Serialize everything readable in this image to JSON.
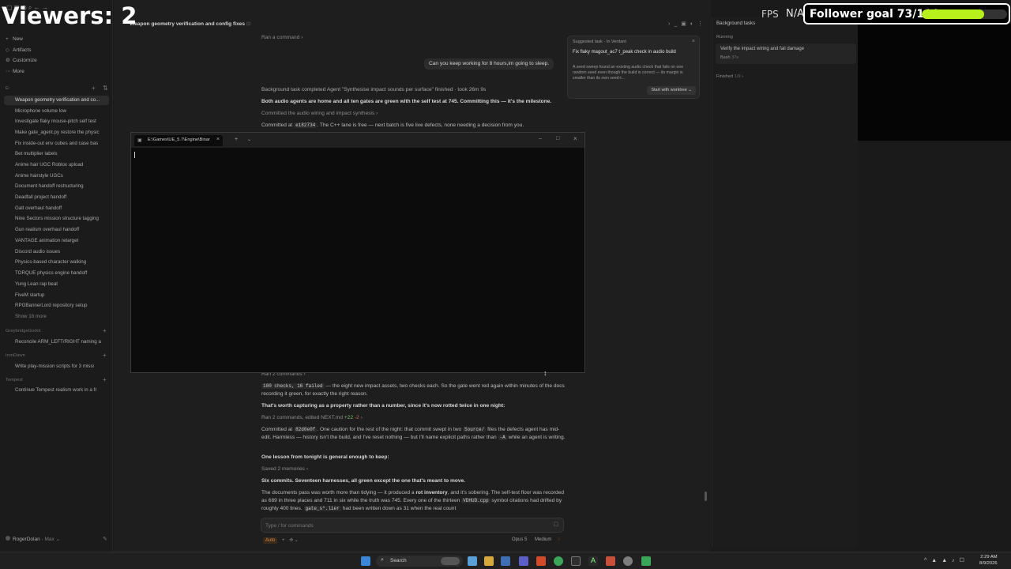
{
  "overlay": {
    "viewers": "Viewers: 2",
    "fps_label": "FPS",
    "fps_value": "N/A",
    "follower_goal": "Follower goal 73/100",
    "goal_progress": 0.73
  },
  "sidebar": {
    "nav": [
      "New",
      "Artifacts",
      "Customize",
      "More"
    ],
    "threads": [
      "Weapon geometry verification and co...",
      "Microphone volume low",
      "Investigate flaky mouse-pitch self test",
      "Make gate_agent.py restore the physic",
      "Fix inside-out env cubes and case bas",
      "Bet multiplier labels",
      "Anime hair UGC Roblox upload",
      "Anime hairstyle UGCs",
      "Document handoff restructuring",
      "Deadfall project handoff",
      "Galt overhaul handoff",
      "Nine Sectors mission structure tagging",
      "Gun realism overhaul handoff",
      "VANTAGE animation retarget",
      "Discord audio issues",
      "Physics-based character walking",
      "TORQUE physics engine handoff",
      "Yung Lean rap beat",
      "FiveM startup",
      "RPGBannerLord repository setup"
    ],
    "show_more": "Show 18 more",
    "groups": [
      {
        "name": "GreybridgeGodot",
        "item": "Reconcile ARM_LEFT/RIGHT naming a"
      },
      {
        "name": "IronDawn",
        "item": "Write play-mission scripts for 3 missi"
      },
      {
        "name": "Tempest",
        "item": "Continue Tempest realism work in a fr"
      }
    ],
    "user": "RogerDolan",
    "plan": "Max"
  },
  "header": {
    "title": "Weapon geometry verification and config fixes",
    "ran": "Ran a command"
  },
  "chat": {
    "user_msg": "Can you keep working for 8 hours,im going to sleep.",
    "bg_done": "Background task completed Agent \"Synthesise impact sounds per surface\" finished · took 26m 9s",
    "audio_home": "Both audio agents are home and all ten gates are green with the self test at 745. Committing this — it's the milestone.",
    "committed_link": "Committed the audio wiring and impact synthesis",
    "commit1_pre": "Committed at",
    "commit1_hash": "e182734",
    "commit1_post": ". The C++ lane is free — next batch is five live defects, none needing a decision from you.",
    "ran2": "Ran 2 commands",
    "checks_code": "100 checks, 16 failed",
    "checks_text": " — the eight new impact assets, two checks each. So the gate went red again within minutes of the docs recording it green, for exactly the right reason.",
    "capture": "That's worth capturing as a property rather than a number, since it's now rotted twice in one night:",
    "ran_edited": "Ran 2 commands, edited NEXT.md",
    "added": "+22",
    "removed": "-2",
    "commit2_pre": "Committed at",
    "commit2_hash": "82d0e0f",
    "commit2_mid": ". One caution for the rest of the night: that commit swept in two",
    "commit2_code": "Source/",
    "commit2_post": "files the defects agent has mid-edit. Harmless — history isn't the build, and I've reset nothing — but I'll name explicit paths rather than",
    "commit2_flag": "-A",
    "commit2_end": "while an agent is writing.",
    "lesson": "One lesson from tonight is general enough to keep:",
    "saved": "Saved 2 memories",
    "six": "Six commits. Seventeen harnesses, all green except the one that's meant to move.",
    "docs_a": "The documents pass was worth more than tidying — it produced a",
    "docs_b": "rot inventory",
    "docs_c": ", and it's sobering. The self-test floor was recorded as 689 in three places and 711 in six while the truth was 745. Every one of the thirteen",
    "docs_code": "VDHUD.cpp",
    "docs_d": "symbol citations had drifted by roughly 400 lines.",
    "docs_code2": "gate_s*.lier",
    "docs_e": "had been written down as 31 when the real count"
  },
  "composer": {
    "placeholder": "Type / for commands",
    "mode": "Auto",
    "model": "Opus 5",
    "effort": "Medium"
  },
  "suggested": {
    "header": "Suggested task · In Verdant",
    "title": "Fix flaky magout_ac7 t_peak check in audio build",
    "body": "A seed sweep found an existing audio check that fails on one random seed even though the build is correct — its margin is smaller than its own seed-t...",
    "button": "Start with worktree"
  },
  "bg_tasks": {
    "title": "Background tasks",
    "running_label": "Running",
    "task": "Verify the impact wiring and fail damage",
    "task_meta": "Bash",
    "task_time": "37s",
    "finished_label": "Finished",
    "finished_count": "1/9"
  },
  "terminal": {
    "tab_title": "E:\\Games\\UE_5.7\\Engine\\Binar"
  },
  "taskbar": {
    "search": "Search",
    "time": "2:29 AM",
    "date": "8/9/2026"
  },
  "colors": {
    "accent": "#d08a4a",
    "goal_fill": "#b7f01a",
    "link": "#8e8e8e"
  }
}
